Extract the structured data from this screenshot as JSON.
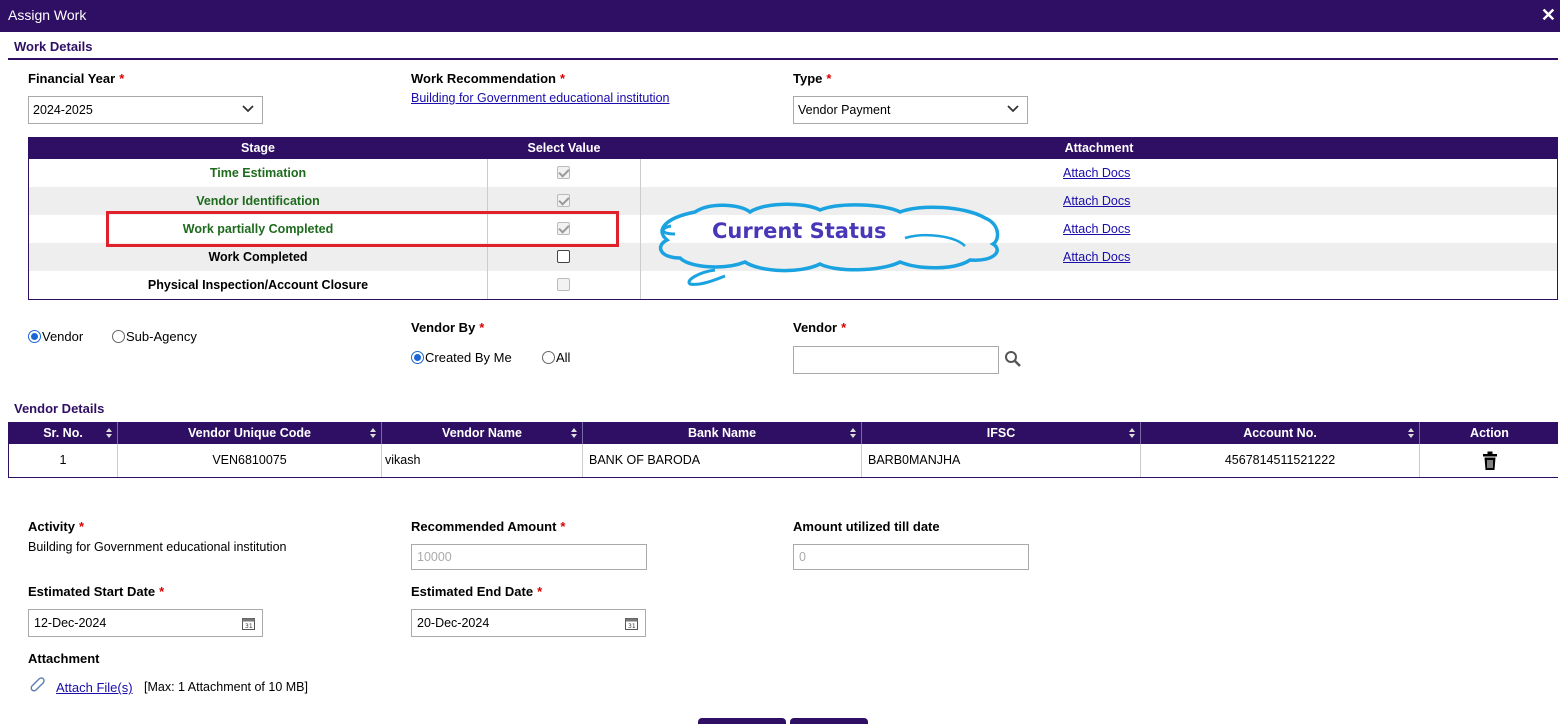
{
  "window": {
    "title": "Assign Work",
    "close_glyph": "✕"
  },
  "work_details": {
    "section_title": "Work Details",
    "financial_year": {
      "label": "Financial Year",
      "value": "2024-2025"
    },
    "work_recommendation": {
      "label": "Work Recommendation",
      "link": "Building for Government educational institution"
    },
    "type": {
      "label": "Type",
      "value": "Vendor Payment"
    },
    "required_mark": "*"
  },
  "stage_table": {
    "headers": [
      "Stage",
      "Select Value",
      "Attachment"
    ],
    "rows": [
      {
        "stage": "Time Estimation",
        "checked": true,
        "attachment": "Attach Docs",
        "color": "green"
      },
      {
        "stage": "Vendor Identification",
        "checked": true,
        "attachment": "Attach Docs",
        "color": "green"
      },
      {
        "stage": "Work partially Completed",
        "checked": true,
        "attachment": "Attach Docs",
        "color": "green"
      },
      {
        "stage": "Work Completed",
        "checked": false,
        "attachment": "Attach Docs",
        "color": "black"
      },
      {
        "stage": "Physical Inspection/Account Closure",
        "checked": false,
        "attachment": "",
        "color": "black"
      }
    ]
  },
  "annotation": {
    "text": "Current Status",
    "cloud_color": "#1aa3e0",
    "box_color": "#e0202a"
  },
  "vendor_select": {
    "options": [
      "Vendor",
      "Sub-Agency"
    ],
    "selected": "Vendor",
    "vendor_by": {
      "label": "Vendor By",
      "options": [
        "Created By Me",
        "All"
      ],
      "selected": "Created By Me"
    },
    "vendor": {
      "label": "Vendor",
      "value": ""
    }
  },
  "vendor_details": {
    "section_title": "Vendor Details",
    "headers": [
      "Sr. No.",
      "Vendor Unique Code",
      "Vendor Name",
      "Bank Name",
      "IFSC",
      "Account No.",
      "Action"
    ],
    "rows": [
      {
        "sr": "1",
        "code": "VEN6810075",
        "name": "vikash",
        "bank": "BANK OF BARODA",
        "ifsc": "BARB0MANJHA",
        "account": "4567814511521222",
        "action_icon": "trash-icon"
      }
    ]
  },
  "activity": {
    "label": "Activity",
    "value": "Building for Government educational institution",
    "recommended_amount": {
      "label": "Recommended Amount",
      "value": "10000"
    },
    "amount_utilized": {
      "label": "Amount utilized till date",
      "value": "0"
    },
    "start_date": {
      "label": "Estimated Start Date",
      "value": "12-Dec-2024"
    },
    "end_date": {
      "label": "Estimated End Date",
      "value": "20-Dec-2024"
    },
    "attachment": {
      "label": "Attachment",
      "link": "Attach File(s)",
      "note": "[Max: 1 Attachment of 10 MB]"
    }
  },
  "colors": {
    "brand": "#2f0f63",
    "link": "#1a0dab",
    "stage_done": "#1e6b1e"
  }
}
